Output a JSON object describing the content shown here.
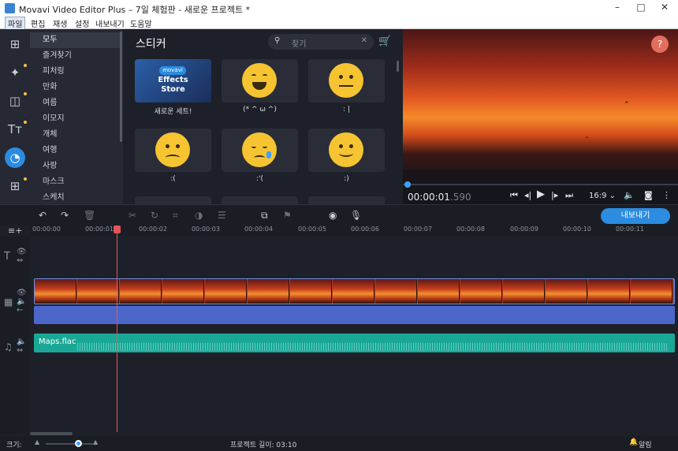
{
  "window": {
    "title": "Movavi Video Editor Plus – 7일 체험판 - 새로운 프로젝트 *",
    "controls": [
      "–",
      "□",
      "✕"
    ]
  },
  "menu": [
    "파일",
    "편집",
    "재생",
    "설정",
    "내보내기",
    "도움말"
  ],
  "categories": [
    "모두",
    "즐겨찾기",
    "피처링",
    "만화",
    "여름",
    "이모지",
    "개체",
    "여행",
    "사랑",
    "마스크",
    "스케치"
  ],
  "stickers": {
    "title": "스티커",
    "search_placeholder": "찾기",
    "promo": {
      "brand": "movavi",
      "line1": "Effects",
      "line2": "Store",
      "label": "새로운 세트!"
    },
    "items": [
      {
        "label": "(* ^ ω ^)"
      },
      {
        "label": ": |"
      },
      {
        "label": ":("
      },
      {
        "label": ":'("
      },
      {
        "label": ":)"
      }
    ]
  },
  "preview": {
    "timecode_main": "00:00:01",
    "timecode_frac": ".590",
    "aspect": "16:9 ⌄"
  },
  "toolbar": {
    "export_label": "내보내기"
  },
  "ruler": [
    "00:00:00",
    "00:00:01",
    "00:00:02",
    "00:00:03",
    "00:00:04",
    "00:00:05",
    "00:00:06",
    "00:00:07",
    "00:00:08",
    "00:00:09",
    "00:00:10",
    "00:00:11"
  ],
  "audio": {
    "filename": "Maps.flac"
  },
  "status": {
    "size_label": "크기:",
    "project_length": "프로젝트 길이: 03:10",
    "alerts": "알림"
  },
  "colors": {
    "accent": "#2b8ce0",
    "playhead": "#e25555",
    "music": "#1aa896",
    "audio_track": "#4c66c9"
  }
}
